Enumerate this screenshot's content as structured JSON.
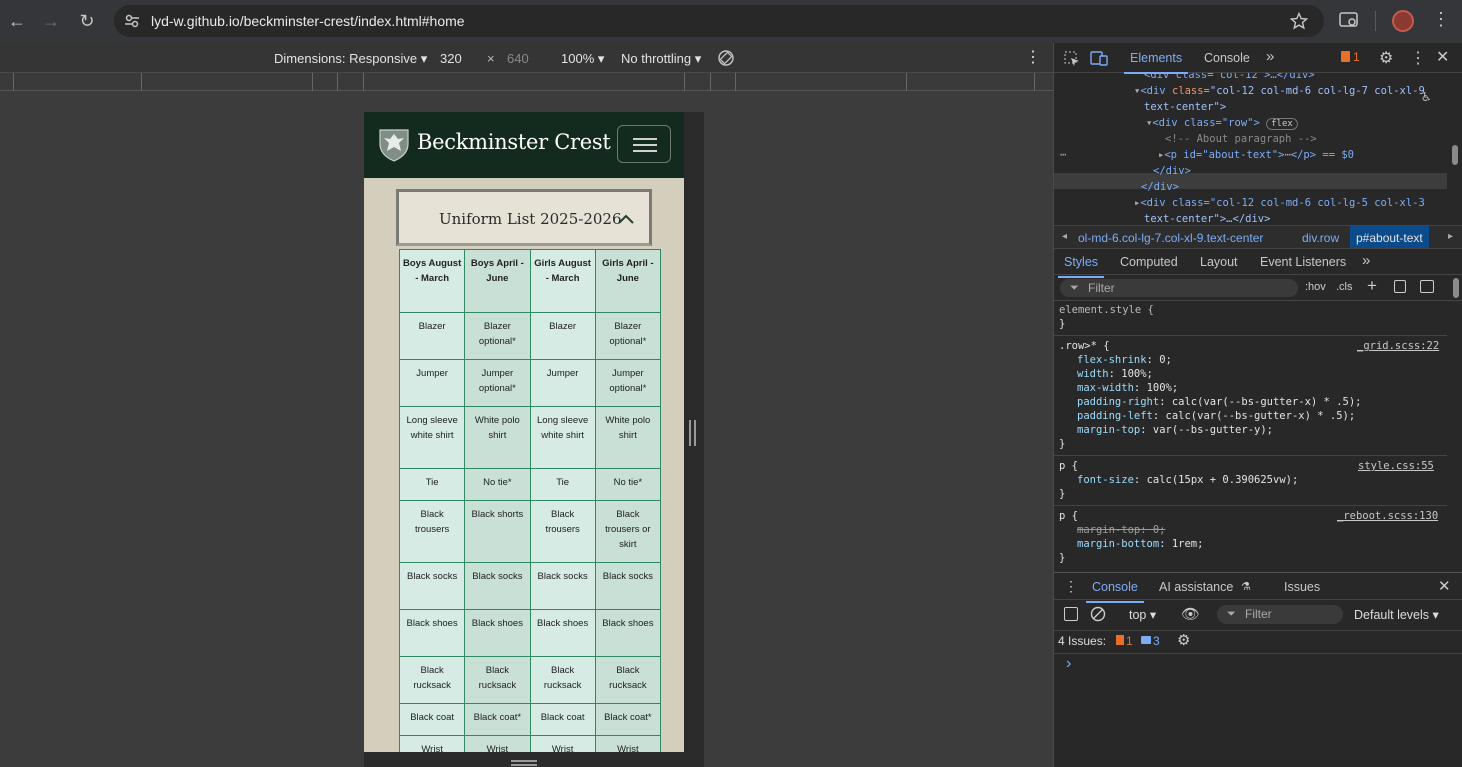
{
  "browser": {
    "url": "lyd-w.github.io/beckminster-crest/index.html#home"
  },
  "device_toolbar": {
    "dimensions_label": "Dimensions: Responsive",
    "width": "320",
    "times": "×",
    "height": "640",
    "zoom": "100%",
    "throttling": "No throttling"
  },
  "site": {
    "brand": "Beckminster Crest",
    "accordion_title": "Uniform List 2025-2026",
    "colors": {
      "nav": "#132a1f",
      "page": "#d4cfbd",
      "table_border": "#2f8a63",
      "cell": "#d5ebe3"
    },
    "table": {
      "headers": [
        "Boys August - March",
        "Boys April - June",
        "Girls August - March",
        "Girls April - June"
      ],
      "rows": [
        [
          "Blazer",
          "Blazer optional*",
          "Blazer",
          "Blazer optional*"
        ],
        [
          "Jumper",
          "Jumper optional*",
          "Jumper",
          "Jumper optional*"
        ],
        [
          "Long sleeve white shirt",
          "White polo shirt",
          "Long sleeve white shirt",
          "White polo shirt"
        ],
        [
          "Tie",
          "No tie*",
          "Tie",
          "No tie*"
        ],
        [
          "Black trousers",
          "Black shorts",
          "Black trousers",
          "Black trousers or skirt"
        ],
        [
          "Black socks",
          "Black socks",
          "Black socks",
          "Black socks"
        ],
        [
          "Black shoes",
          "Black shoes",
          "Black shoes",
          "Black shoes"
        ],
        [
          "Black rucksack",
          "Black rucksack",
          "Black rucksack",
          "Black rucksack"
        ],
        [
          "Black coat",
          "Black coat*",
          "Black coat",
          "Black coat*"
        ],
        [
          "Wrist",
          "Wrist",
          "Wrist",
          "Wrist"
        ]
      ]
    }
  },
  "devtools": {
    "tabs": {
      "elements": "Elements",
      "console": "Console",
      "more": "»"
    },
    "issues_count": "1",
    "dom": {
      "l0": "<div class=\"col-12\">…</div>",
      "l1_tag": "<div",
      "l1_attr": "class=",
      "l1_val": "\"col-12 col-md-6 col-lg-7 col-xl-9",
      "l2": "text-center\">",
      "l3_tag": "<div class=\"row\">",
      "l3_badge": "flex",
      "l4": "<!-- About paragraph -->",
      "l5_tag": "<p id=\"about-text\">",
      "l5_tail": "</p> == $0",
      "l6": "</div>",
      "l7": "</div>",
      "l8": "<div class=\"col-12 col-md-6 col-lg-5 col-xl-3",
      "l9": "text-center\">…</div>"
    },
    "breadcrumbs": [
      "ol-md-6.col-lg-7.col-xl-9.text-center",
      "div.row",
      "p#about-text"
    ],
    "styles_tabs": {
      "styles": "Styles",
      "computed": "Computed",
      "layout": "Layout",
      "listeners": "Event Listeners",
      "more": "»"
    },
    "filter_placeholder": "Filter",
    "hov": ":hov",
    "cls": ".cls",
    "rules": {
      "element_style": "element.style {",
      "close": "}",
      "row_selector": ".row>* {",
      "row_src": "_grid.scss:22",
      "row_props": [
        [
          "flex-shrink",
          "0;"
        ],
        [
          "width",
          "100%;"
        ],
        [
          "max-width",
          "100%;"
        ],
        [
          "padding-right",
          "calc(var(--bs-gutter-x) * .5);"
        ],
        [
          "padding-left",
          "calc(var(--bs-gutter-x) * .5);"
        ],
        [
          "margin-top",
          "var(--bs-gutter-y);"
        ]
      ],
      "p1_selector": "p {",
      "p1_src": "style.css:55",
      "p1_prop": [
        "font-size",
        "calc(15px + 0.390625vw);"
      ],
      "p2_selector": "p {",
      "p2_src": "_reboot.scss:130",
      "p2_struck": "margin-top: 0;",
      "p2_prop": [
        "margin-bottom",
        "1rem;"
      ]
    },
    "drawer": {
      "console_tab": "Console",
      "ai_tab": "AI assistance",
      "issues_tab": "Issues",
      "context": "top",
      "filter": "Filter",
      "levels": "Default levels",
      "issues_label": "4 Issues:",
      "issues_errors": "1",
      "issues_info": "3",
      "prompt": "›"
    }
  }
}
